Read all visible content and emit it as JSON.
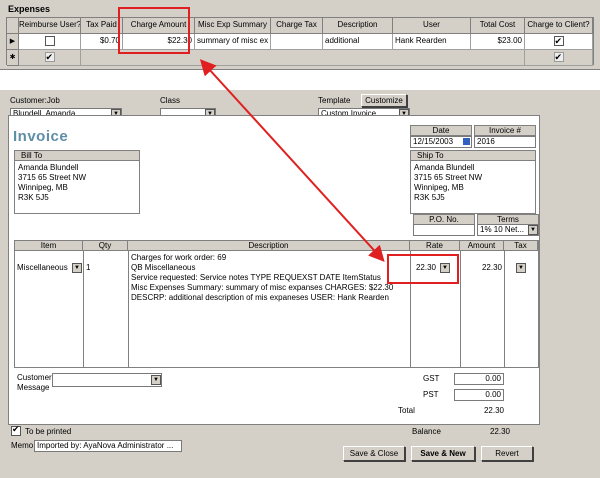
{
  "expenses": {
    "title": "Expenses",
    "columns": [
      "Reimburse User?",
      "Tax Paid",
      "Charge Amount",
      "Misc Exp Summary",
      "Charge Tax",
      "Description",
      "User",
      "Total Cost",
      "Charge to Client?"
    ],
    "row": {
      "reimburse": false,
      "tax_paid": "$0.70",
      "charge_amount": "$22.30",
      "misc_summary": "summary of misc ex",
      "charge_tax": "",
      "description": "additional",
      "user": "Hank Rearden",
      "total_cost": "$23.00",
      "charge_to_client": true
    },
    "row_pointer_icon": "triangle-right",
    "new_row_icon": "asterisk"
  },
  "form": {
    "customer_job_label": "Customer:Job",
    "customer_job_value": "Blundell, Amanda",
    "class_label": "Class",
    "class_value": "",
    "template_label": "Template",
    "customize_label": "Customize",
    "template_value": "Custom Invoice",
    "invoice_title": "Invoice",
    "date_label": "Date",
    "date_value": "12/15/2003",
    "invoice_no_label": "Invoice #",
    "invoice_no_value": "2016",
    "bill_to_label": "Bill To",
    "bill_to_lines": [
      "Amanda Blundell",
      "3715 65 Street NW",
      "Winnipeg, MB",
      "R3K 5J5"
    ],
    "ship_to_label": "Ship To",
    "ship_to_lines": [
      "Amanda Blundell",
      "3715 65 Street NW",
      "Winnipeg, MB",
      "R3K 5J5"
    ],
    "po_label": "P.O. No.",
    "po_value": "",
    "terms_label": "Terms",
    "terms_value": "1% 10 Net...",
    "columns": {
      "item": "Item",
      "qty": "Qty",
      "description": "Description",
      "rate": "Rate",
      "amount": "Amount",
      "tax": "Tax"
    },
    "line": {
      "item": "Miscellaneous",
      "qty": "1",
      "description_lines": [
        "Charges for work order: 69",
        "QB Miscellaneous",
        "Service requested:  Service notes  TYPE  REQUEXST DATE  ItemStatus",
        "Misc Expenses Summary: summary of misc expanses  CHARGES: $22.30",
        "DESCRP:  additional description of mis expaneses USER: Hank Rearden"
      ],
      "rate": "22.30",
      "amount": "22.30"
    },
    "customer_message_label_1": "Customer",
    "customer_message_label_2": "Message",
    "gst_label": "GST",
    "gst_value": "0.00",
    "pst_label": "PST",
    "pst_value": "0.00",
    "total_label": "Total",
    "total_value": "22.30",
    "to_be_printed_label": "To be printed",
    "to_be_printed": true,
    "balance_label": "Balance",
    "balance_value": "22.30",
    "memo_label": "Memo",
    "memo_value": "Imported by: AyaNova Administrator ...",
    "save_close_label": "Save & Close",
    "save_new_label": "Save & New",
    "revert_label": "Revert"
  },
  "colors": {
    "highlight": "#e02020",
    "invoice_title": "#5f8ea8",
    "panel": "#d4d0c8"
  }
}
